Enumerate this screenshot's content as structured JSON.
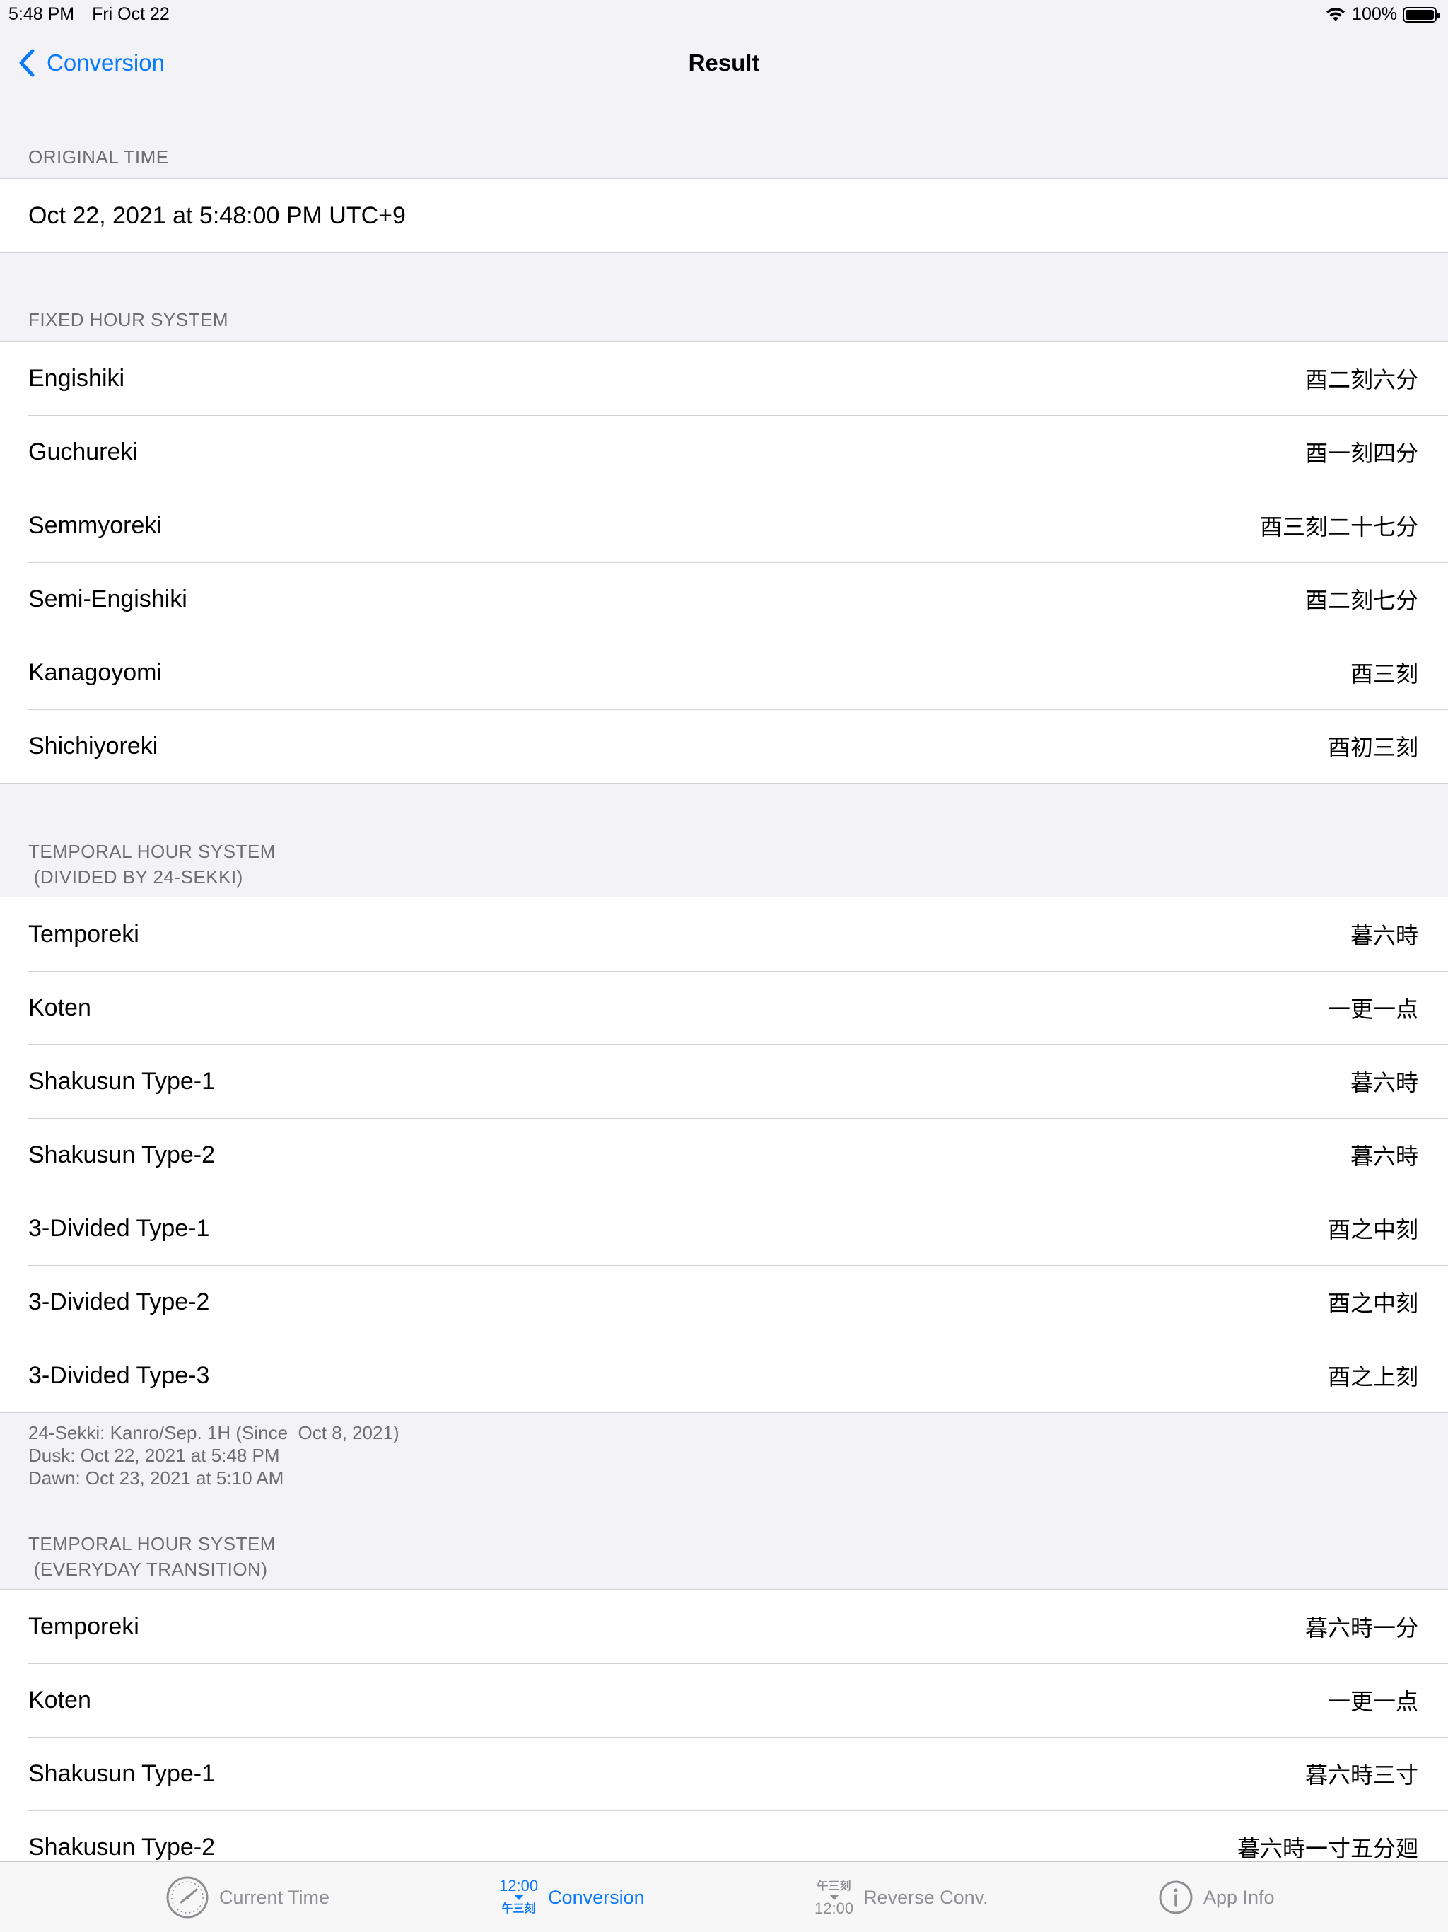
{
  "status": {
    "time": "5:48 PM",
    "date": "Fri Oct 22",
    "battery": "100%"
  },
  "nav": {
    "back_label": "Conversion",
    "title": "Result"
  },
  "original": {
    "header": "ORIGINAL TIME",
    "value": "Oct 22, 2021 at 5:48:00 PM UTC+9"
  },
  "fixed": {
    "header": "FIXED HOUR SYSTEM",
    "rows": [
      {
        "label": "Engishiki",
        "value": "酉二刻六分"
      },
      {
        "label": "Guchureki",
        "value": "酉一刻四分"
      },
      {
        "label": "Semmyoreki",
        "value": "酉三刻二十七分"
      },
      {
        "label": "Semi-Engishiki",
        "value": "酉二刻七分"
      },
      {
        "label": "Kanagoyomi",
        "value": "酉三刻"
      },
      {
        "label": "Shichiyoreki",
        "value": "酉初三刻"
      }
    ]
  },
  "temporal_sekki": {
    "header_line1": "TEMPORAL HOUR SYSTEM",
    "header_line2": " (DIVIDED BY 24-SEKKI)",
    "rows": [
      {
        "label": "Temporeki",
        "value": "暮六時"
      },
      {
        "label": "Koten",
        "value": "一更一点"
      },
      {
        "label": "Shakusun Type-1",
        "value": "暮六時"
      },
      {
        "label": "Shakusun Type-2",
        "value": "暮六時"
      },
      {
        "label": "3-Divided Type-1",
        "value": "酉之中刻"
      },
      {
        "label": "3-Divided Type-2",
        "value": "酉之中刻"
      },
      {
        "label": "3-Divided Type-3",
        "value": "酉之上刻"
      }
    ],
    "footer_line1": "24-Sekki: Kanro/Sep. 1H (Since  Oct 8, 2021)",
    "footer_line2": "Dusk: Oct 22, 2021 at 5:48 PM",
    "footer_line3": "Dawn: Oct 23, 2021 at 5:10 AM"
  },
  "temporal_everyday": {
    "header_line1": "TEMPORAL HOUR SYSTEM",
    "header_line2": " (EVERYDAY TRANSITION)",
    "rows": [
      {
        "label": "Temporeki",
        "value": "暮六時一分"
      },
      {
        "label": "Koten",
        "value": "一更一点"
      },
      {
        "label": "Shakusun Type-1",
        "value": "暮六時三寸"
      },
      {
        "label": "Shakusun Type-2",
        "value": "暮六時一寸五分廻"
      }
    ]
  },
  "tabs": {
    "current_time": "Current Time",
    "conversion": "Conversion",
    "conversion_icon_top": "12:00",
    "conversion_icon_bottom": "午三刻",
    "reverse": "Reverse Conv.",
    "reverse_icon_top": "午三刻",
    "reverse_icon_bottom": "12:00",
    "app_info": "App Info"
  },
  "colors": {
    "accent": "#0a7aff",
    "background": "#f2f2f7",
    "secondary_text": "#6d6d72",
    "tab_inactive": "#8e8e93"
  }
}
